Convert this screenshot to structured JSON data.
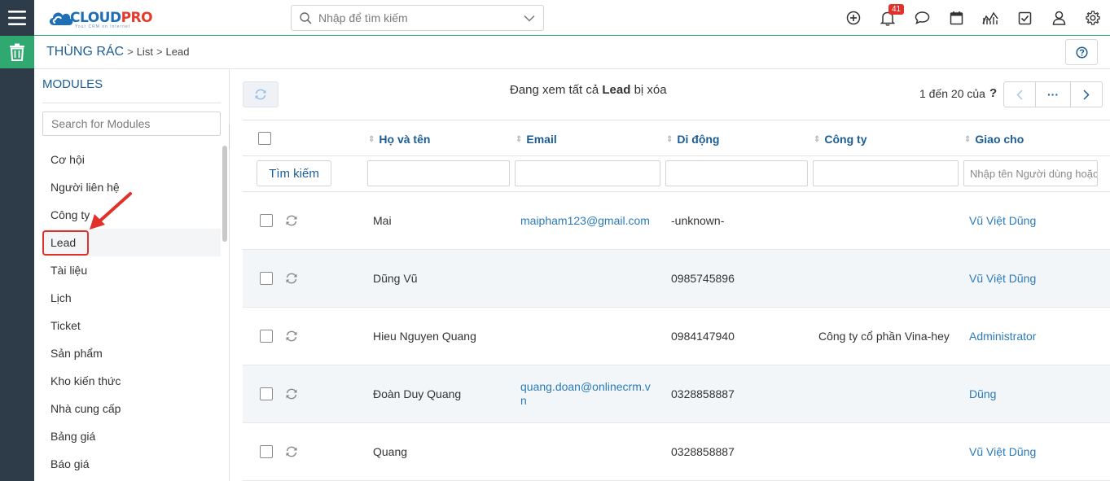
{
  "header": {
    "logo_main": "CLOUD",
    "logo_accent": "PRO",
    "logo_tagline": "Your CRM on Internet",
    "search_placeholder": "Nhập để tìm kiếm",
    "notification_count": "41"
  },
  "breadcrumb": {
    "main": "THÙNG RÁC",
    "sep1": ">",
    "part1": "List",
    "sep2": ">",
    "part2": "Lead"
  },
  "modules": {
    "title": "MODULES",
    "search_placeholder": "Search for Modules",
    "items": [
      {
        "label": "Cơ hội"
      },
      {
        "label": "Người liên hệ"
      },
      {
        "label": "Công ty"
      },
      {
        "label": "Lead"
      },
      {
        "label": "Tài liệu"
      },
      {
        "label": "Lịch"
      },
      {
        "label": "Ticket"
      },
      {
        "label": "Sản phẩm"
      },
      {
        "label": "Kho kiến thức"
      },
      {
        "label": "Nhà cung cấp"
      },
      {
        "label": "Bảng giá"
      },
      {
        "label": "Báo giá"
      }
    ],
    "active": "Lead"
  },
  "content": {
    "viewing_prefix": "Đang xem tất cả",
    "viewing_module": "Lead",
    "viewing_suffix": "bị xóa",
    "pager_text": "1 đến 20 của",
    "pager_q": "?",
    "pager_more": "···"
  },
  "table": {
    "columns": {
      "name": "Họ và tên",
      "email": "Email",
      "mobile": "Di động",
      "company": "Công ty",
      "assigned": "Giao cho"
    },
    "search_button": "Tìm kiếm",
    "assigned_filter_placeholder": "Nhập tên Người dùng hoặc Nhóm",
    "rows": [
      {
        "name": "Mai",
        "email1": "maipham123@gmail.com",
        "email2": "",
        "mobile": "-unknown-",
        "company": "",
        "assigned": "Vũ Việt Dũng"
      },
      {
        "name": "Dũng Vũ",
        "email1": "",
        "email2": "",
        "mobile": "0985745896",
        "company": "",
        "assigned": "Vũ Việt Dũng"
      },
      {
        "name": "Hieu Nguyen Quang",
        "email1": "",
        "email2": "",
        "mobile": "0984147940",
        "company": "Công ty cổ phần Vina-hey",
        "assigned": "Administrator"
      },
      {
        "name": "Đoàn Duy Quang",
        "email1": "quang.doan@onlinecrm.v",
        "email2": "n",
        "mobile": "0328858887",
        "company": "",
        "assigned": "Dũng"
      },
      {
        "name": "Quang",
        "email1": "",
        "email2": "",
        "mobile": "0328858887",
        "company": "",
        "assigned": "Vũ Việt Dũng"
      }
    ]
  },
  "colors": {
    "brand_blue": "#1c5d94",
    "link_blue": "#2b7bb9",
    "green": "#2fa96f",
    "rail": "#2e3b48",
    "alert_red": "#e0312a"
  }
}
